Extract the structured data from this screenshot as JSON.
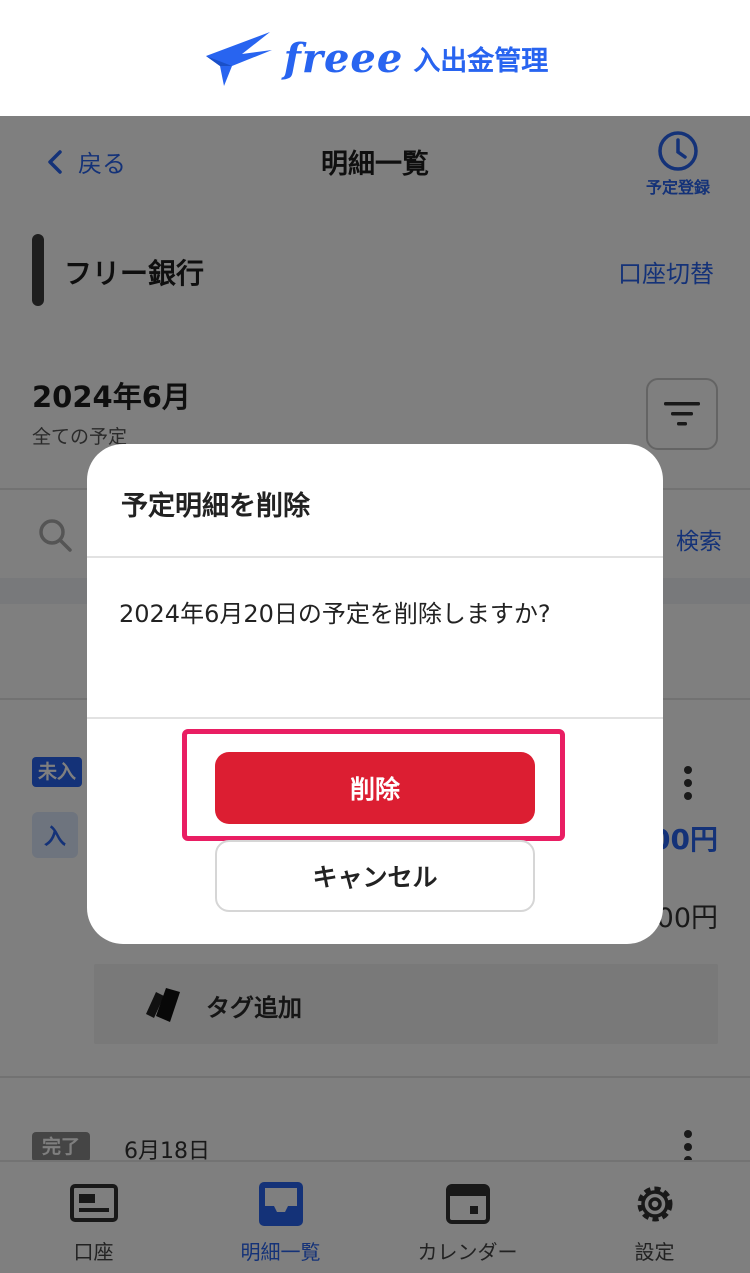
{
  "header": {
    "logo_text": "freee",
    "product_name": "入出金管理"
  },
  "nav": {
    "back_label": "戻る",
    "title": "明細一覧",
    "schedule_label": "予定登録"
  },
  "account": {
    "name": "フリー銀行",
    "switch_label": "口座切替"
  },
  "period": {
    "month": "2024年6月",
    "filter_label": "全ての予定"
  },
  "search": {
    "button_label": "検索"
  },
  "entry1": {
    "status_badge": "未入",
    "type_badge": "入",
    "amount_primary": "00円",
    "amount_secondary": "00円",
    "tag_add_label": "タグ追加"
  },
  "entry2": {
    "status_badge": "完了",
    "date": "6月18日"
  },
  "tabbar": {
    "items": [
      {
        "label": "口座"
      },
      {
        "label": "明細一覧"
      },
      {
        "label": "カレンダー"
      },
      {
        "label": "設定"
      }
    ]
  },
  "dialog": {
    "title": "予定明細を削除",
    "message": "2024年6月20日の予定を削除しますか?",
    "delete_label": "削除",
    "cancel_label": "キャンセル"
  },
  "colors": {
    "brand": "#2864f0",
    "danger": "#dc1e32",
    "highlight": "#e91e63"
  }
}
